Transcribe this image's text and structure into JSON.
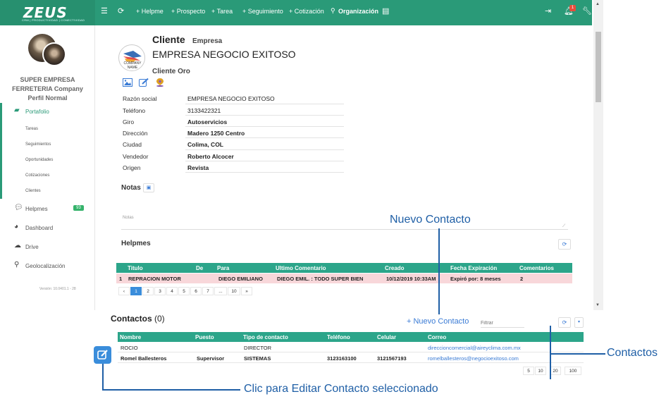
{
  "topbar": {
    "logo": "ZEUS",
    "logo_sub": "CRM | PRODUCTIVIDAD | CONECTIVIDAD",
    "items": [
      "+ Helpme",
      "+ Prospecto",
      "+ Tarea",
      "+ Seguimiento",
      "+ Cotización",
      "Organización"
    ],
    "notification_count": "1"
  },
  "sidebar": {
    "company_line1": "SUPER EMPRESA",
    "company_line2": "FERRETERIA Company",
    "profile": "Perfil Normal",
    "portafolio": "Portafolio",
    "sub_items": [
      "Tareas",
      "Seguimientos",
      "Oportunidades",
      "Cotizaciones",
      "Clientes"
    ],
    "helpmes": "Helpmes",
    "helpmes_count": "93",
    "dashboard": "Dashboard",
    "drive": "Drive",
    "geo": "Geolocalización",
    "version": "Versión: 10.0401.1 - 28"
  },
  "client": {
    "title": "Cliente",
    "type": "Empresa",
    "name": "EMPRESA NEGOCIO EXITOSO",
    "level": "Cliente Oro",
    "logo_text": "COMPANY NAME",
    "fields": [
      {
        "label": "Razón social",
        "value": "EMPRESA NEGOCIO EXITOSO"
      },
      {
        "label": "Teléfono",
        "value": "3133422321"
      },
      {
        "label": "Giro",
        "value": "Autoservicios"
      },
      {
        "label": "Dirección",
        "value": "Madero 1250 Centro"
      },
      {
        "label": "Ciudad",
        "value": "Colima, COL"
      },
      {
        "label": "Vendedor",
        "value": "Roberto Alcocer"
      },
      {
        "label": "Origen",
        "value": "Revista"
      }
    ]
  },
  "notes": {
    "title": "Notas",
    "placeholder": "Notas"
  },
  "helpmes": {
    "title": "Helpmes",
    "columns": [
      "Titulo",
      "De",
      "Para",
      "Ultimo Comentario",
      "Creado",
      "Fecha Expiración",
      "Comentarios"
    ],
    "rows": [
      {
        "num": "1",
        "titulo": "REPRACION MOTOR",
        "de": "",
        "para": "DIEGO EMILIANO",
        "comentario": "DIEGO EMIL. : TODO SUPER BIEN",
        "creado": "10/12/2019 10:33AM",
        "expira": "Expiró por: 8 meses",
        "comentarios": "2"
      }
    ],
    "pages": [
      "‹",
      "1",
      "2",
      "3",
      "4",
      "5",
      "6",
      "7",
      "...",
      "10",
      "»"
    ]
  },
  "contacts": {
    "title": "Contactos",
    "count": "(0)",
    "new_button": "+ Nuevo Contacto",
    "filter_placeholder": "Filtrar",
    "columns": [
      "Nombre",
      "Puesto",
      "Tipo de contacto",
      "Teléfono",
      "Celular",
      "Correo"
    ],
    "rows": [
      {
        "nombre": "ROCIO",
        "puesto": "",
        "tipo": "DIRECTOR",
        "telefono": "",
        "celular": "",
        "correo": "direccioncomercial@aireyclima.com.mx"
      },
      {
        "nombre": "Romel Ballesteros",
        "puesto": "Supervisor",
        "tipo": "SISTEMAS",
        "telefono": "3123163100",
        "celular": "3121567193",
        "correo": "romelballesteros@negocioexitoso.com"
      }
    ],
    "page_sizes": [
      "5",
      "10",
      "20",
      "100"
    ]
  },
  "annotations": {
    "nuevo": "Nuevo Contacto",
    "contactos": "Contactos",
    "editar": "Clic para Editar Contacto seleccionado"
  },
  "colors": {
    "brand": "#2a9a78",
    "header": "#2ca58a",
    "row_highlight": "#f8d7da",
    "link": "#3a7bd5",
    "annotation": "#1f5fa6"
  }
}
